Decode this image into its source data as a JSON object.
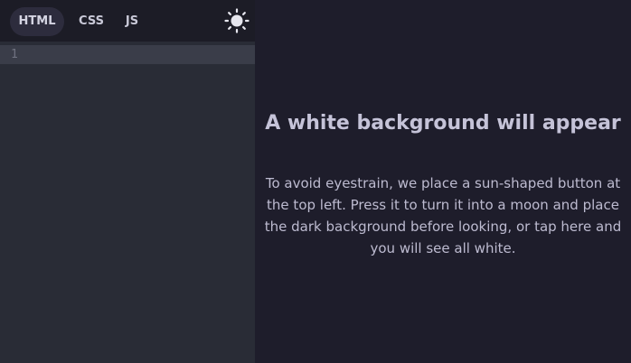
{
  "tabs": [
    {
      "label": "HTML",
      "active": true
    },
    {
      "label": "CSS",
      "active": false
    },
    {
      "label": "JS",
      "active": false
    }
  ],
  "theme_toggle": {
    "icon": "sun-icon"
  },
  "editor": {
    "line_numbers": [
      "1"
    ]
  },
  "preview": {
    "title": "A white background will appear",
    "text": "To avoid eyestrain, we place a sun-shaped button at the top left. Press it to turn it into a moon and place the dark background before looking, or tap here and you will see all white."
  },
  "colors": {
    "background": "#1e1e2a",
    "editor_bg": "#292c36",
    "active_line": "#3a3d49",
    "tab_active": "#2d2c3d",
    "text": "#c5c3d8"
  }
}
